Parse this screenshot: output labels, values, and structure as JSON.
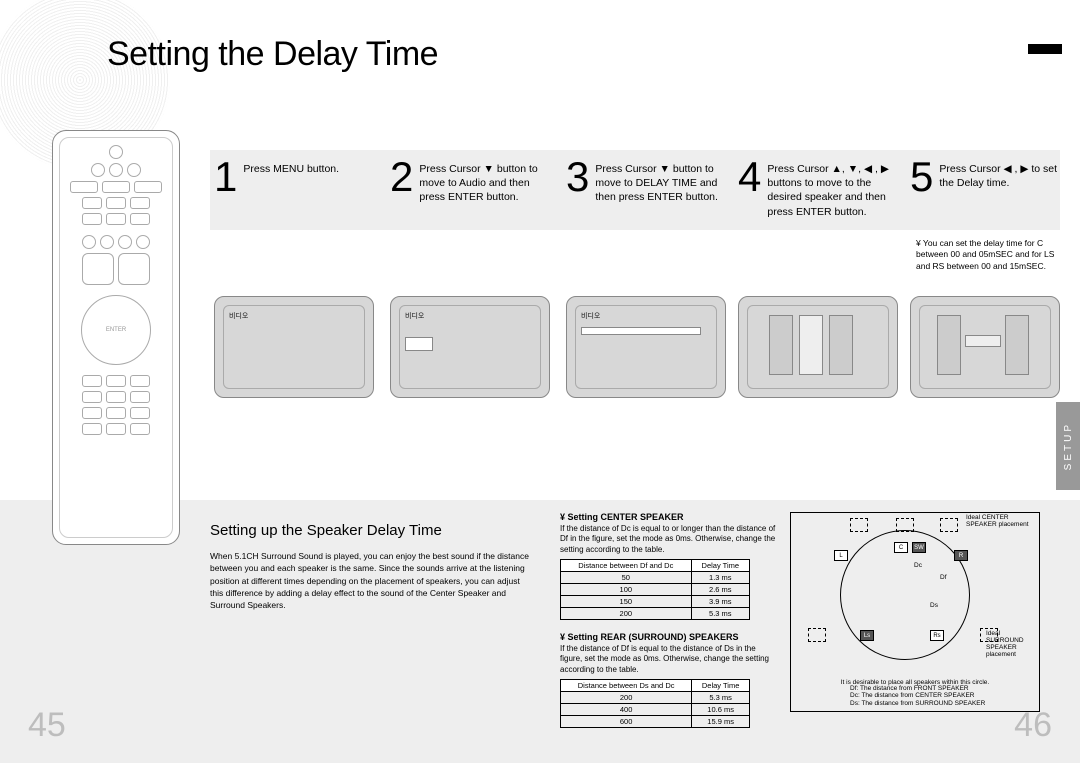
{
  "page_title": "Setting the Delay Time",
  "side_tab": "SETUP",
  "page_left": "45",
  "page_right": "46",
  "steps": [
    {
      "num": "1",
      "text": "Press MENU button.",
      "tv_label": "비디오"
    },
    {
      "num": "2",
      "text": "Press Cursor ▼ button to move to  Audio  and then press ENTER button.",
      "tv_label": "비디오"
    },
    {
      "num": "3",
      "text": "Press Cursor ▼ button to move to  DELAY TIME  and then press ENTER button.",
      "tv_label": "비디오"
    },
    {
      "num": "4",
      "text": "Press Cursor ▲, ▼, ◀ , ▶ buttons to move to the desired speaker and then press ENTER button."
    },
    {
      "num": "5",
      "text": "Press Cursor ◀ , ▶ to set the Delay time."
    }
  ],
  "note": "¥ You can set the delay time for C between 00 and 05mSEC and for LS and RS between 00 and 15mSEC.",
  "subsection_title": "Setting up the Speaker Delay Time",
  "body_text": "When 5.1CH Surround Sound is played, you can enjoy the best sound if the distance between you and each speaker is the same. Since the sounds arrive at the listening position at different times depending on the placement of speakers, you can adjust this difference by adding a delay effect to the sound of the Center Speaker and Surround Speakers.",
  "center": {
    "heading": "¥ Setting CENTER SPEAKER",
    "text": "If the distance of Dc is equal to or longer than the distance of Df in the figure, set the mode as 0ms. Otherwise, change the setting according to the table.",
    "table": {
      "head": [
        "Distance between Df and Dc",
        "Delay Time"
      ],
      "rows": [
        [
          "50",
          "1.3 ms"
        ],
        [
          "100",
          "2.6 ms"
        ],
        [
          "150",
          "3.9 ms"
        ],
        [
          "200",
          "5.3 ms"
        ]
      ]
    }
  },
  "rear": {
    "heading": "¥ Setting REAR (SURROUND) SPEAKERS",
    "text": "If the distance of Df is equal to the distance of Ds in the figure, set the mode as 0ms. Otherwise, change the setting according to the table.",
    "table": {
      "head": [
        "Distance between Ds and Dc",
        "Delay Time"
      ],
      "rows": [
        [
          "200",
          "5.3 ms"
        ],
        [
          "400",
          "10.6 ms"
        ],
        [
          "600",
          "15.9 ms"
        ]
      ]
    }
  },
  "diagram": {
    "ideal_center": "Ideal CENTER SPEAKER placement",
    "ideal_surround": "Ideal SURROUND SPEAKER placement",
    "labels": {
      "L": "L",
      "C": "C",
      "R": "R",
      "SW": "SW",
      "Ls": "Ls",
      "Rs": "Rs",
      "Dc": "Dc",
      "Df": "Df",
      "Ds": "Ds"
    },
    "note": "It is desirable to place all speakers within this circle.",
    "legend": [
      "Df: The distance from FRONT SPEAKER",
      "Dc: The distance from CENTER SPEAKER",
      "Ds: The distance from SURROUND SPEAKER"
    ]
  }
}
